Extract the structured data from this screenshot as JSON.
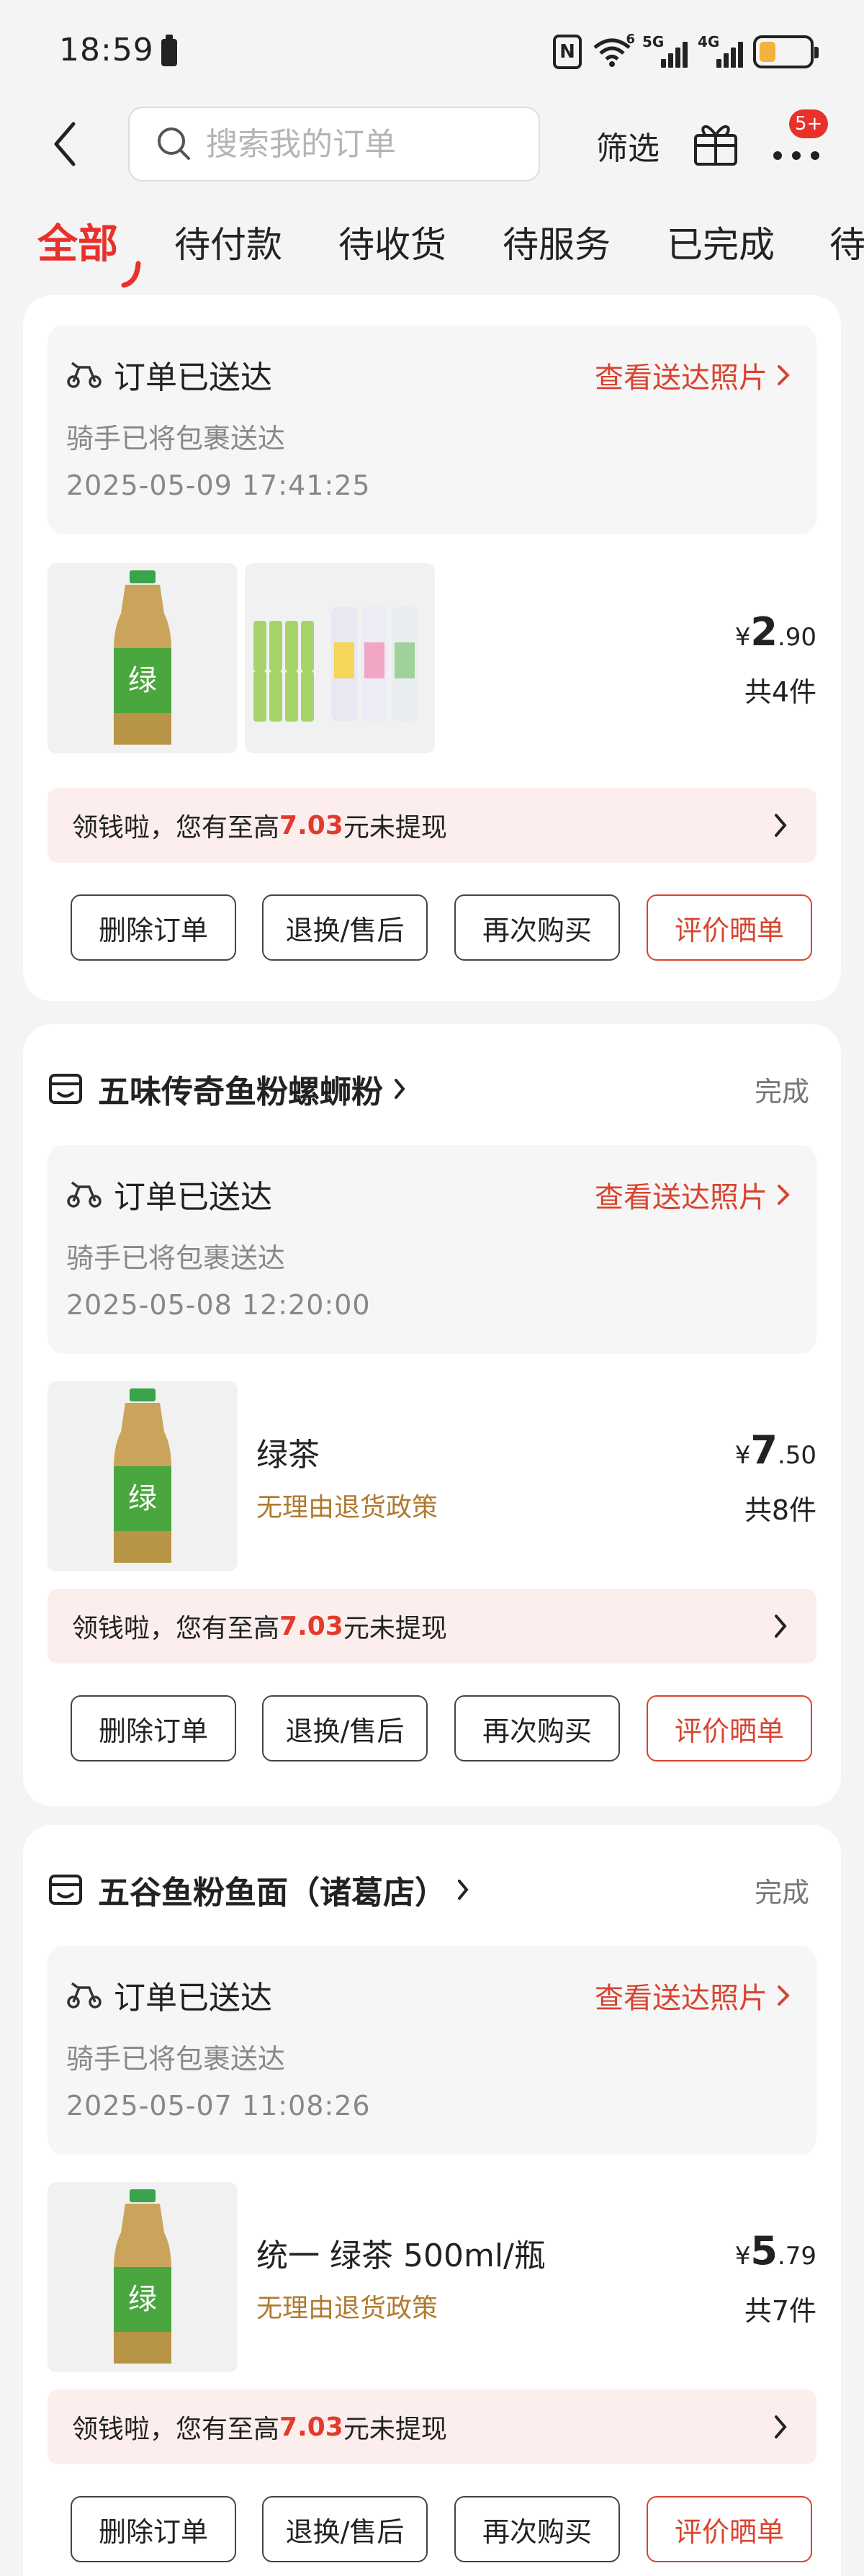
{
  "status_bar": {
    "time": "18:59",
    "nfc": "N",
    "net1": "5G",
    "net2": "4G",
    "wifi_label": "6"
  },
  "header": {
    "search_placeholder": "搜索我的订单",
    "filter_label": "筛选",
    "more_badge": "5+"
  },
  "tabs": [
    "全部",
    "待付款",
    "待收货",
    "待服务",
    "已完成",
    "待"
  ],
  "cash_banner": {
    "prefix": "领钱啦，您有至高",
    "amount": "7.03",
    "suffix": "元未提现"
  },
  "buttons": {
    "delete": "删除订单",
    "after_sale": "退换/售后",
    "rebuy": "再次购买",
    "review": "评价晒单"
  },
  "orders": [
    {
      "delivery": {
        "title": "订单已送达",
        "link": "查看送达照片",
        "subtitle": "骑手已将包裹送达",
        "time": "2025-05-09 17:41:25"
      },
      "price": {
        "currency": "¥",
        "integer": "2",
        "decimal": ".90"
      },
      "count": "共4件"
    },
    {
      "store": "五味传奇鱼粉螺蛳粉",
      "status": "完成",
      "delivery": {
        "title": "订单已送达",
        "link": "查看送达照片",
        "subtitle": "骑手已将包裹送达",
        "time": "2025-05-08 12:20:00"
      },
      "product_name": "绿茶",
      "policy": "无理由退货政策",
      "price": {
        "currency": "¥",
        "integer": "7",
        "decimal": ".50"
      },
      "count": "共8件"
    },
    {
      "store": "五谷鱼粉鱼面（诸葛店）",
      "status": "完成",
      "delivery": {
        "title": "订单已送达",
        "link": "查看送达照片",
        "subtitle": "骑手已将包裹送达",
        "time": "2025-05-07 11:08:26"
      },
      "product_name": "统一 绿茶 500ml/瓶",
      "policy": "无理由退货政策",
      "price": {
        "currency": "¥",
        "integer": "5",
        "decimal": ".79"
      },
      "count": "共7件"
    }
  ],
  "colors": {
    "accent": "#e8312b",
    "link": "#d8442f",
    "policy": "#b07a2e",
    "banner_bg": "#fdeeee"
  }
}
